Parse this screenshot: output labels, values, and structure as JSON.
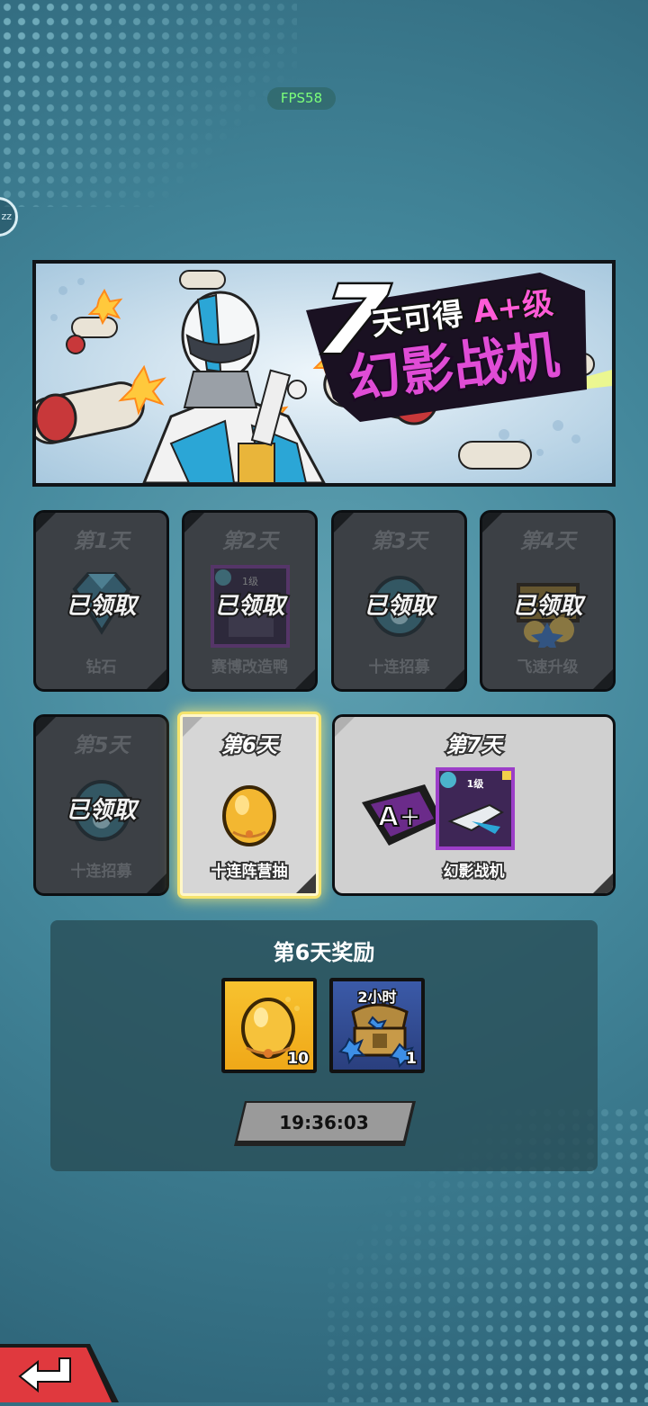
{
  "fps": "FPS58",
  "side_button": "zz",
  "banner": {
    "big_number": "7",
    "line1_prefix": "天可得",
    "line1_grade": "A+级",
    "line2": "幻影战机"
  },
  "days": [
    {
      "day": "第1天",
      "name": "钻石",
      "status": "已领取",
      "icon": "diamond-icon"
    },
    {
      "day": "第2天",
      "name": "赛博改造鸭",
      "status": "已领取",
      "icon": "duck-card-icon",
      "level": "1级"
    },
    {
      "day": "第3天",
      "name": "十连招募",
      "status": "已领取",
      "icon": "recruit-egg-icon"
    },
    {
      "day": "第4天",
      "name": "飞速升级",
      "status": "已领取",
      "icon": "treasure-chest-icon"
    },
    {
      "day": "第5天",
      "name": "十连招募",
      "status": "已领取",
      "icon": "recruit-egg-icon"
    },
    {
      "day": "第6天",
      "name": "十连阵营抽",
      "status": "",
      "icon": "golden-egg-icon"
    },
    {
      "day": "第7天",
      "name": "幻影战机",
      "status": "",
      "icon": "phantom-fighter-card-icon",
      "level": "1级",
      "grade": "A+"
    }
  ],
  "reward_panel": {
    "title": "第6天奖励",
    "items": [
      {
        "icon": "golden-egg-icon",
        "count": "10"
      },
      {
        "icon": "time-chest-icon",
        "duration": "2小时",
        "count": "1"
      }
    ],
    "countdown": "19:36:03"
  },
  "colors": {
    "active_glow": "#f4e36c",
    "banner_title": "#e04cd6",
    "fps_text": "#7cff7a",
    "back_button": "#e0393e"
  }
}
